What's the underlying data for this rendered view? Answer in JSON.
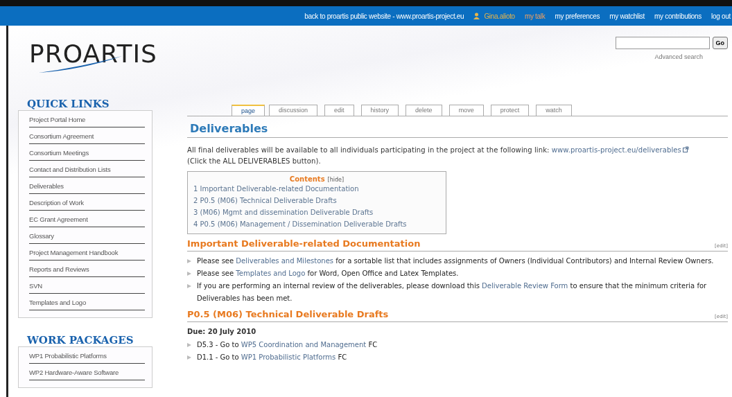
{
  "top_bar": {
    "links": [
      {
        "label": "back to proartis public website - www.proartis-project.eu",
        "kind": "plain"
      },
      {
        "label": "Gina.alioto",
        "kind": "user"
      },
      {
        "label": "my talk",
        "kind": "highlight"
      },
      {
        "label": "my preferences",
        "kind": "plain"
      },
      {
        "label": "my watchlist",
        "kind": "plain"
      },
      {
        "label": "my contributions",
        "kind": "plain"
      },
      {
        "label": "log out",
        "kind": "plain"
      }
    ]
  },
  "logo": {
    "text": "PROARTIS"
  },
  "search": {
    "button": "Go",
    "advanced": "Advanced search"
  },
  "sidebar": [
    {
      "title": "QUICK LINKS",
      "items": [
        {
          "label": "Project Portal Home"
        },
        {
          "label": "Consortium Agreement"
        },
        {
          "label": "Consortium Meetings"
        },
        {
          "label": "Contact and Distribution Lists"
        },
        {
          "label": "Deliverables"
        },
        {
          "label": "Description of Work"
        },
        {
          "label": "EC Grant Agreement"
        },
        {
          "label": "Glossary"
        },
        {
          "label": "Project Management Handbook"
        },
        {
          "label": "Reports and Reviews"
        },
        {
          "label": "SVN"
        },
        {
          "label": "Templates and Logo"
        }
      ]
    },
    {
      "title": "WORK PACKAGES",
      "items": [
        {
          "label": "WP1 Probabilistic Platforms"
        },
        {
          "label": "WP2 Hardware-Aware Software"
        }
      ]
    }
  ],
  "tabs": [
    {
      "label": "page",
      "selected": true
    },
    {
      "label": "discussion",
      "selected": false
    },
    {
      "label": "edit",
      "selected": false
    },
    {
      "label": "history",
      "selected": false
    },
    {
      "label": "delete",
      "selected": false
    },
    {
      "label": "move",
      "selected": false
    },
    {
      "label": "protect",
      "selected": false
    },
    {
      "label": "watch",
      "selected": false
    }
  ],
  "page_title": "Deliverables",
  "intro": {
    "text": "All final deliverables will be available to all individuals participating in the project at the following link:",
    "link": "www.proartis-project.eu/deliverables",
    "after": "(Click the ALL DELIVERABLES button)."
  },
  "toc": {
    "title": "Contents",
    "toggle": "[hide]",
    "items": [
      "1 Important Deliverable-related Documentation",
      "2 P0.5 (M06) Technical Deliverable Drafts",
      "3 (M06) Mgmt and dissemination Deliverable Drafts",
      "4 P0.5 (M06) Management / Dissemination Deliverable Drafts"
    ]
  },
  "sections": [
    {
      "heading": "Important Deliverable-related Documentation",
      "edit": "[edit]",
      "bullets": [
        {
          "before": "Please see",
          "link": "Deliverables and Milestones",
          "after": "for a sortable list that includes assignments of Owners (Individual Contributors) and Internal Review Owners."
        },
        {
          "before": "Please see",
          "link": "Templates and Logo",
          "after": "for Word, Open Office and Latex Templates."
        },
        {
          "before": "If you are performing an internal review of the deliverables, please download this",
          "link": "Deliverable Review Form",
          "after": "to ensure that the minimum criteria for Deliverables has been met."
        }
      ]
    },
    {
      "heading": "P0.5 (M06) Technical Deliverable Drafts",
      "edit": "[edit]",
      "due": "Due: 20 July 2010",
      "bullets": [
        {
          "before": "D5.3 - Go to",
          "link": "WP5 Coordination and Management",
          "after": "FC"
        },
        {
          "before": "D1.1 - Go to",
          "link": "WP1 Probabilistic Platforms",
          "after": "FC"
        }
      ]
    }
  ]
}
